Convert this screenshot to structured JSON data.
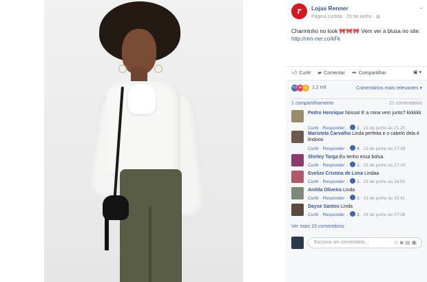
{
  "post": {
    "page_name": "Lojas Renner",
    "logo_letter": "r",
    "meta": "Página curtida · 23 de junho · ",
    "globe_icon": "globe-icon",
    "menu_icon": "chevron-down-icon",
    "message": "Charminho no look ",
    "message_emoji": "🎀🎀🎀",
    "message_tail": " Vem ver a blusa no site: ",
    "link": "http://ren-ner.co/kFk"
  },
  "actions": {
    "like": "Curtir",
    "comment": "Comentar",
    "share": "Compartilhar"
  },
  "reactions": {
    "count": "1,2 mil",
    "filter": "Comentários mais relevantes ▾",
    "shares": "1 compartilhamento",
    "comments_count": "21 comentários"
  },
  "comments": [
    {
      "author": "Pedro Henrique",
      "text": "Nossa! E a mina vem junto? kkkkkk",
      "actions": "Curtir · Responder · ",
      "likes": "1",
      "time": " · 23 de junho às 21:25",
      "avatar_color": "#9c8b6a"
    },
    {
      "author": "Maristela Carvalho",
      "text": "Linda perfeita e o cabelo dela é lindooo",
      "actions": "Curtir · Responder · ",
      "likes": "4",
      "time": " · 23 de junho às 17:39",
      "avatar_color": "#6d5a4a"
    },
    {
      "author": "Shirley Targa",
      "text": "Eu tenho essa bolsa.",
      "actions": "Curtir · Responder · ",
      "likes": "1",
      "time": " · 23 de junho às 17:10",
      "avatar_color": "#8b3a6b"
    },
    {
      "author": "Evelize Cristina de Lima",
      "text": "Lindaa",
      "actions": "Curtir · Responder · ",
      "likes": "1",
      "time": " · 23 de junho às 16:50",
      "avatar_color": "#b3586a"
    },
    {
      "author": "Anilda Oliveira",
      "text": "Linda",
      "actions": "Curtir · Responder · ",
      "likes": "1",
      "time": " · 23 de junho às 15:41",
      "avatar_color": "#7c8a76"
    },
    {
      "author": "Dayse Santos",
      "text": "Linda",
      "actions": "Curtir · Responder · ",
      "likes": "1",
      "time": " · 24 de junho às 07:38",
      "avatar_color": "#5c4a3c"
    }
  ],
  "more_comments": "Ver mais 15 comentários",
  "composer": {
    "placeholder": "Escreva um comentário..."
  }
}
